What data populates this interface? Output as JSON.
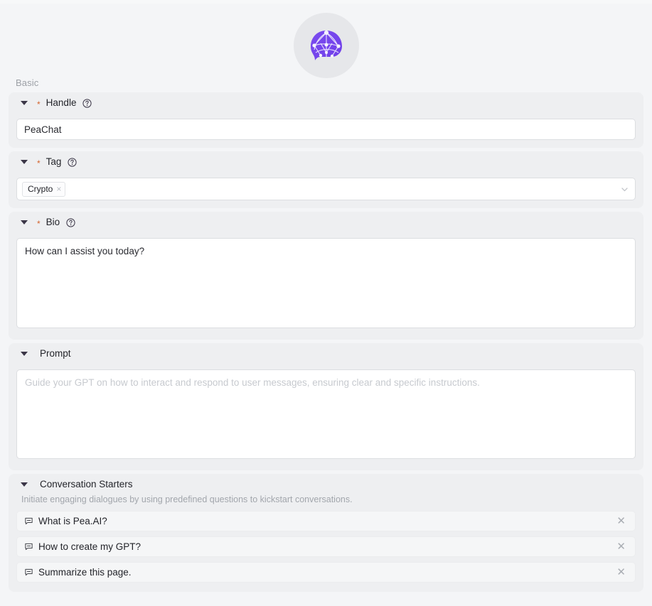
{
  "avatar": {
    "name": "gpt-avatar",
    "icon": "brain-network-icon",
    "brand_color": "#7b4cf0",
    "bg_color": "#e6e7ea"
  },
  "section": {
    "label": "Basic"
  },
  "required_marker": "*",
  "colors": {
    "page_bg": "#f4f5f7",
    "panel_bg": "#eeeff1",
    "input_bg": "#ffffff",
    "required_star": "#d4652f",
    "accent": "#7b4cf0"
  },
  "handle": {
    "title": "Handle",
    "required": true,
    "help_icon": "question-circle-icon",
    "caret_icon": "caret-down-icon",
    "value": "PeaChat",
    "placeholder": ""
  },
  "tag": {
    "title": "Tag",
    "required": true,
    "help_icon": "question-circle-icon",
    "caret_icon": "caret-down-icon",
    "arrow_icon": "chevron-down-icon",
    "chips": [
      {
        "label": "Crypto",
        "close_icon": "close-icon",
        "close_label": "×"
      }
    ]
  },
  "bio": {
    "title": "Bio",
    "required": true,
    "help_icon": "question-circle-icon",
    "caret_icon": "caret-down-icon",
    "value": "How can I assist you today?",
    "placeholder": ""
  },
  "prompt": {
    "title": "Prompt",
    "required": false,
    "caret_icon": "caret-down-icon",
    "value": "",
    "placeholder": "Guide your GPT on how to interact and respond to user messages, ensuring clear and specific instructions."
  },
  "conversation_starters": {
    "title": "Conversation Starters",
    "caret_icon": "caret-down-icon",
    "description": "Initiate engaging dialogues by using predefined questions to kickstart conversations.",
    "item_icon": "chat-bubble-icon",
    "remove_icon": "close-icon",
    "remove_label": "✕",
    "items": [
      {
        "text": "What is Pea.AI?"
      },
      {
        "text": "How to create my GPT?"
      },
      {
        "text": "Summarize this page."
      }
    ]
  }
}
